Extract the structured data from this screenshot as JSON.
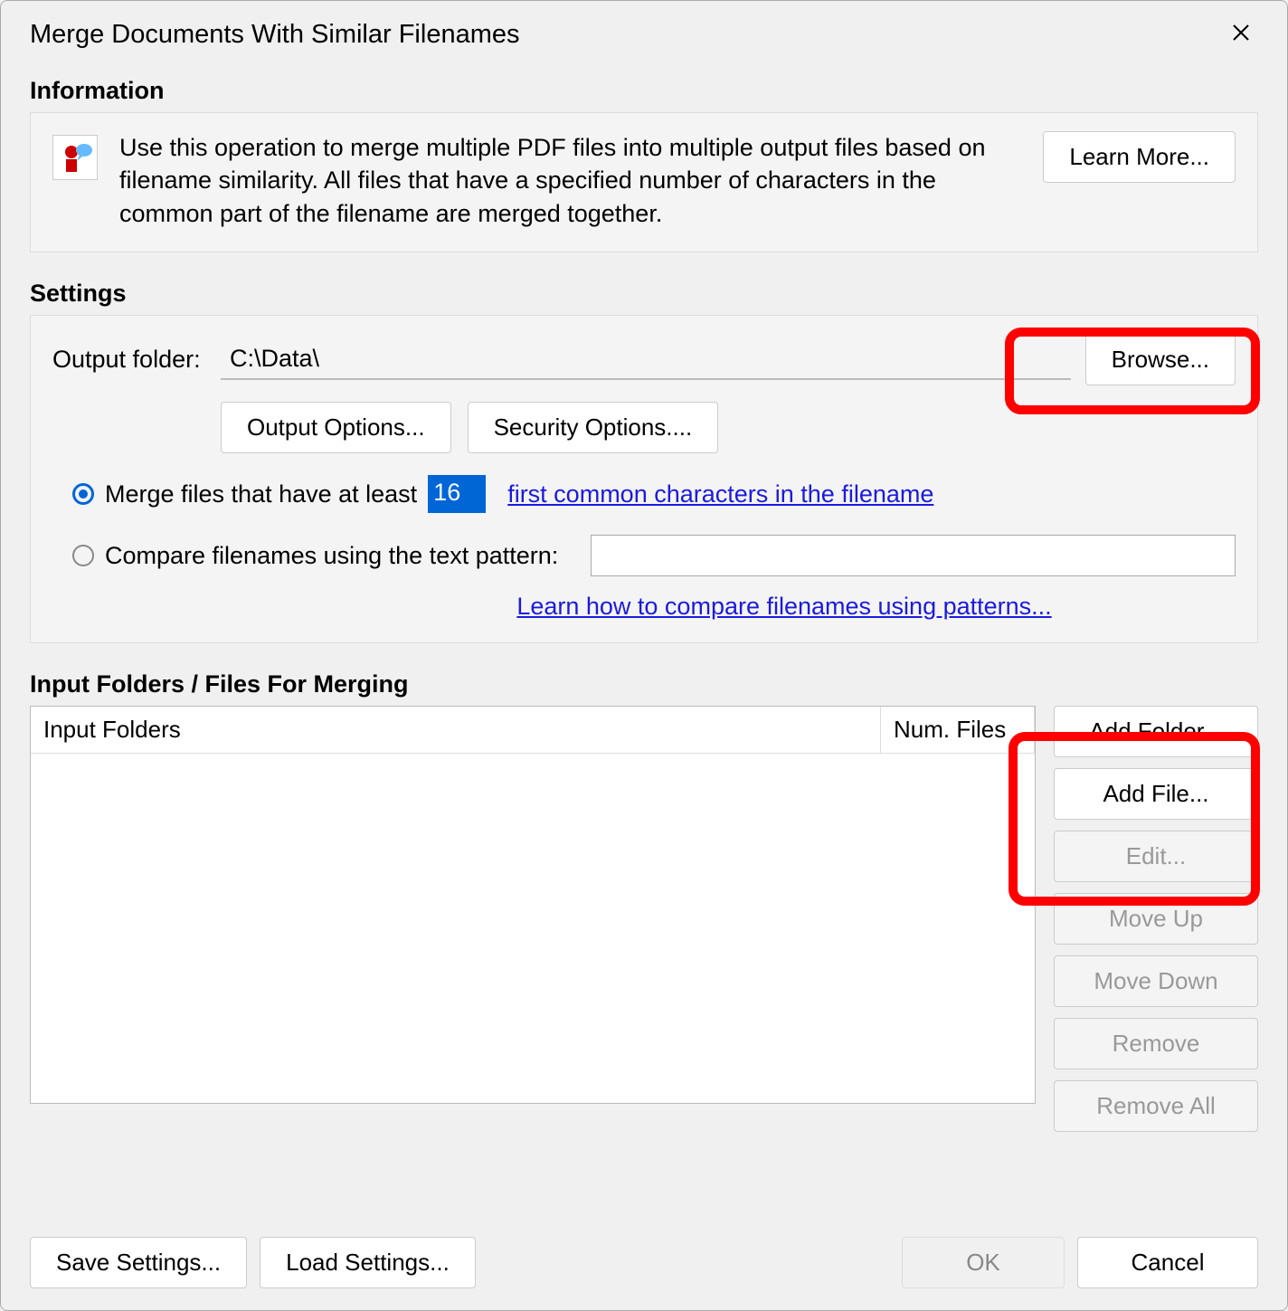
{
  "dialog": {
    "title": "Merge Documents With Similar Filenames"
  },
  "information": {
    "header": "Information",
    "description": "Use this operation to merge multiple PDF files into multiple output files based on filename similarity. All files that have a specified number of characters in the common part of the filename are merged together.",
    "learn_more": "Learn More..."
  },
  "settings": {
    "header": "Settings",
    "output_folder_label": "Output folder:",
    "output_folder_value": "C:\\Data\\",
    "browse": "Browse...",
    "output_options": "Output Options...",
    "security_options": "Security Options....",
    "radio1_prefix": "Merge files that have at least",
    "radio1_value": "16",
    "radio1_link": "first common characters in the filename",
    "radio2_label": "Compare filenames using the text pattern:",
    "pattern_value": "",
    "learn_patterns_link": "Learn how to compare filenames using patterns..."
  },
  "input_section": {
    "header": "Input Folders / Files For Merging",
    "col_input_folders": "Input Folders",
    "col_num_files": "Num. Files",
    "add_folder": "Add Folder...",
    "add_file": "Add File...",
    "edit": "Edit...",
    "move_up": "Move Up",
    "move_down": "Move Down",
    "remove": "Remove",
    "remove_all": "Remove All"
  },
  "footer": {
    "save_settings": "Save Settings...",
    "load_settings": "Load Settings...",
    "ok": "OK",
    "cancel": "Cancel"
  }
}
